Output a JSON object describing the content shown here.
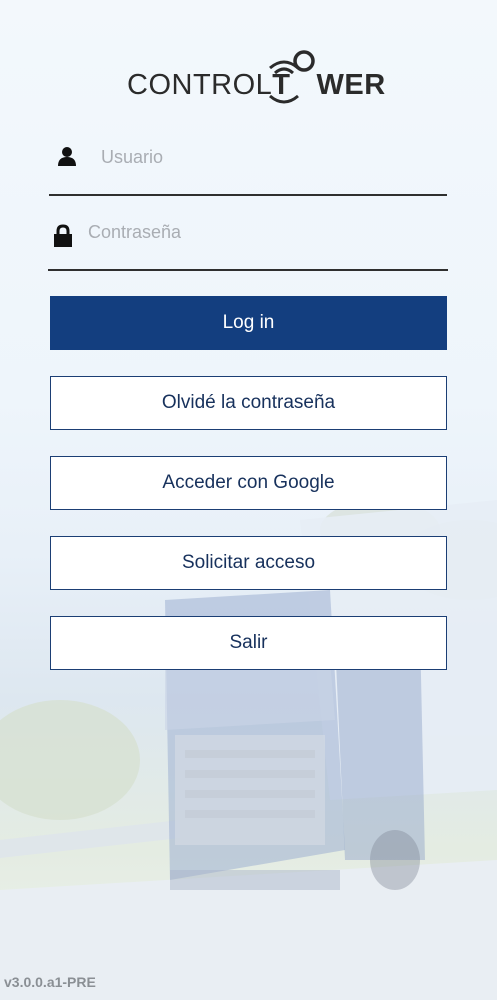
{
  "logo": {
    "light": "CONTROL",
    "bold_t": "T",
    "bold_rest": "WER"
  },
  "form": {
    "username_placeholder": "Usuario",
    "password_placeholder": "Contraseña"
  },
  "buttons": {
    "login": "Log in",
    "forgot": "Olvidé la contraseña",
    "google": "Acceder con Google",
    "request": "Solicitar acceso",
    "exit": "Salir"
  },
  "version": "v3.0.0.a1-PRE",
  "colors": {
    "primary": "#133e7f",
    "border": "#1b3e74",
    "text_dark": "#17315c"
  },
  "icons": [
    "user-icon",
    "lock-icon"
  ]
}
